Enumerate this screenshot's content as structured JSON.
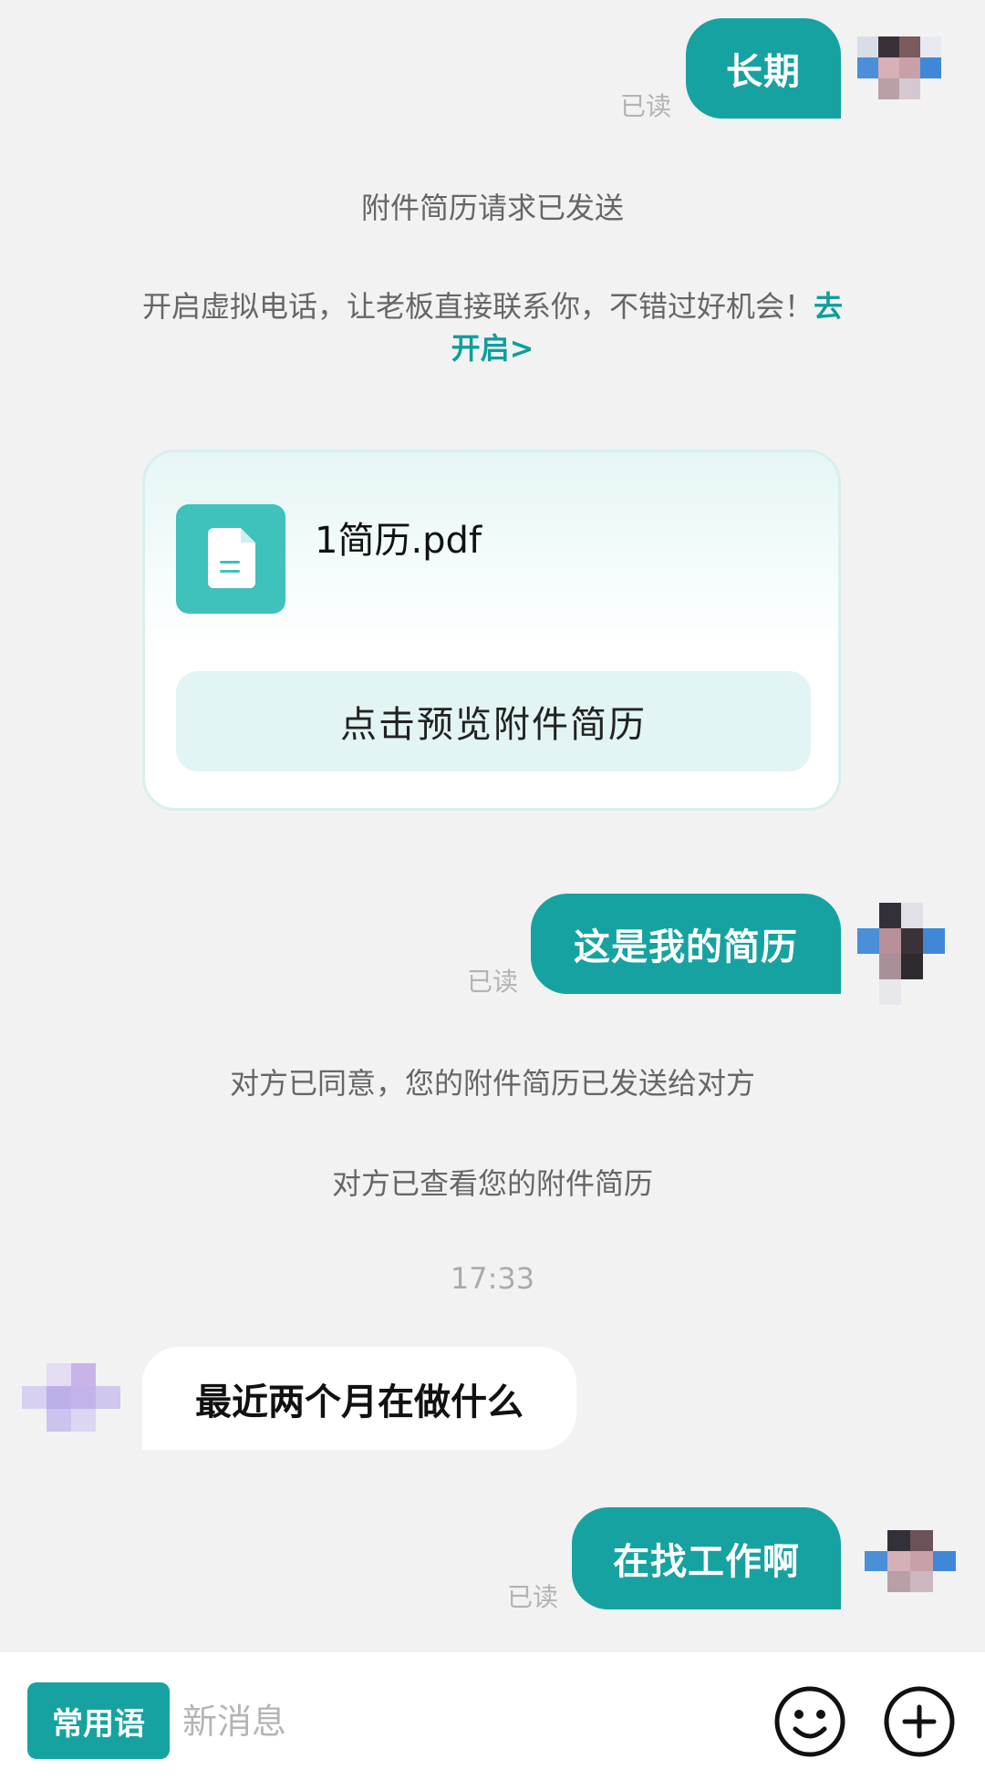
{
  "messages": {
    "m1": {
      "text": "长期",
      "read": "已读"
    },
    "sys1": "附件简历请求已发送",
    "sys2": {
      "text": "开启虚拟电话，让老板直接联系你，不错过好机会！",
      "link": "去开启>"
    },
    "card": {
      "file_name": "1简历.pdf",
      "preview_label": "点击预览附件简历"
    },
    "m2": {
      "text": "这是我的简历",
      "read": "已读"
    },
    "sys3": "对方已同意，您的附件简历已发送给对方",
    "sys4": "对方已查看您的附件简历",
    "time": "17:33",
    "in1": {
      "text": "最近两个月在做什么"
    },
    "m3": {
      "text": "在找工作啊",
      "read": "已读"
    }
  },
  "bottom": {
    "phrase_label": "常用语",
    "input_placeholder": "新消息",
    "emoji_icon": "smiley-icon",
    "plus_icon": "plus-circle-icon"
  },
  "colors": {
    "accent": "#17a2a2",
    "link": "#0f9e9e",
    "background": "#f2f2f2"
  }
}
